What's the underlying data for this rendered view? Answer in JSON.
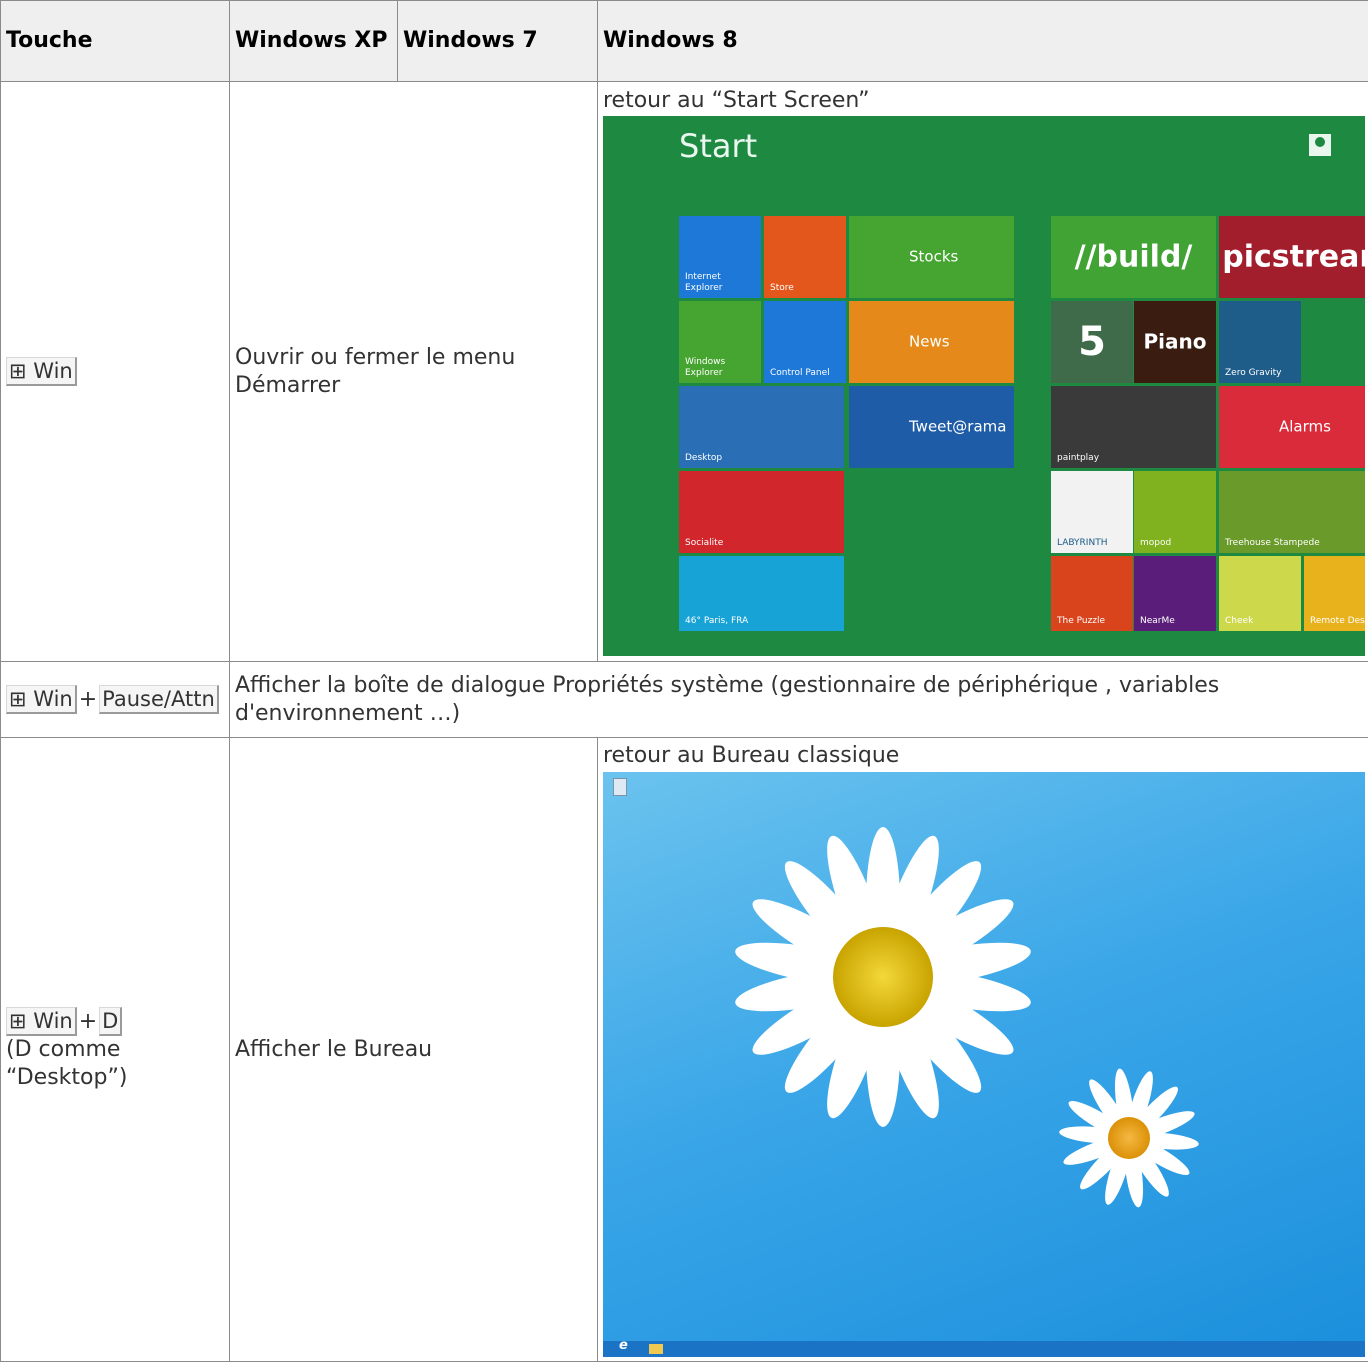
{
  "table": {
    "headers": {
      "key": "Touche",
      "xp": "Windows XP",
      "win7": "Windows 7",
      "win8": "Windows 8"
    },
    "rows": [
      {
        "keys": [
          "⊞ Win"
        ],
        "key_note": "",
        "xp_win7": "Ouvrir ou fermer le menu Démarrer",
        "win8_caption": "retour au “Start Screen”"
      },
      {
        "keys": [
          "⊞ Win",
          "Pause/Attn"
        ],
        "description": "Afficher la boîte de dialogue Propriétés système (gestionnaire de périphérique , variables d'environnement …)"
      },
      {
        "keys": [
          "⊞ Win",
          "D"
        ],
        "key_note": "(D comme “Desktop”)",
        "xp_win7": "Afficher le Bureau",
        "win8_caption": "retour au Bureau classique"
      }
    ],
    "plus": "+"
  },
  "start_screen": {
    "title": "Start",
    "tiles": [
      {
        "label": "Internet Explorer",
        "color": "#1e78d8"
      },
      {
        "label": "Store",
        "color": "#e4571c"
      },
      {
        "label": "Stocks",
        "color": "#46a531"
      },
      {
        "label": "//build/",
        "color": "#40a333"
      },
      {
        "label": "picstrean",
        "color": "#a21e2c"
      },
      {
        "label": "Windows Explorer",
        "color": "#46a531"
      },
      {
        "label": "Control Panel",
        "color": "#1e78d8"
      },
      {
        "label": "News",
        "color": "#e4891a"
      },
      {
        "label": "5",
        "color": "#3f6b4a"
      },
      {
        "label": "Piano",
        "color": "#3a1d10"
      },
      {
        "label": "Zero Gravity",
        "color": "#1e5c8a"
      },
      {
        "label": "Desktop",
        "color": "#2a6fb5"
      },
      {
        "label": "Tweet@rama",
        "color": "#1e5ca8"
      },
      {
        "label": "paintplay",
        "color": "#3a3a3a"
      },
      {
        "label": "Alarms",
        "color": "#d92b3a"
      },
      {
        "label": "Socialite",
        "color": "#d0262c"
      },
      {
        "label": "LABYRINTH",
        "color": "#f2f2f2"
      },
      {
        "label": "mopod",
        "color": "#7fb21e"
      },
      {
        "label": "Treehouse Stampede",
        "color": "#6a9a2a"
      },
      {
        "label": "46° Paris, FRA",
        "color": "#17a3d6"
      },
      {
        "label": "The Puzzle",
        "color": "#d9441c"
      },
      {
        "label": "NearMe",
        "color": "#5a1e7a"
      },
      {
        "label": "Cheek",
        "color": "#cdd84a"
      },
      {
        "label": "Remote Desktop",
        "color": "#e8b21c"
      }
    ],
    "background": "#1e8a41"
  },
  "desktop": {
    "background": "#3aa6e8",
    "taskbar_color": "#1a73c4"
  }
}
